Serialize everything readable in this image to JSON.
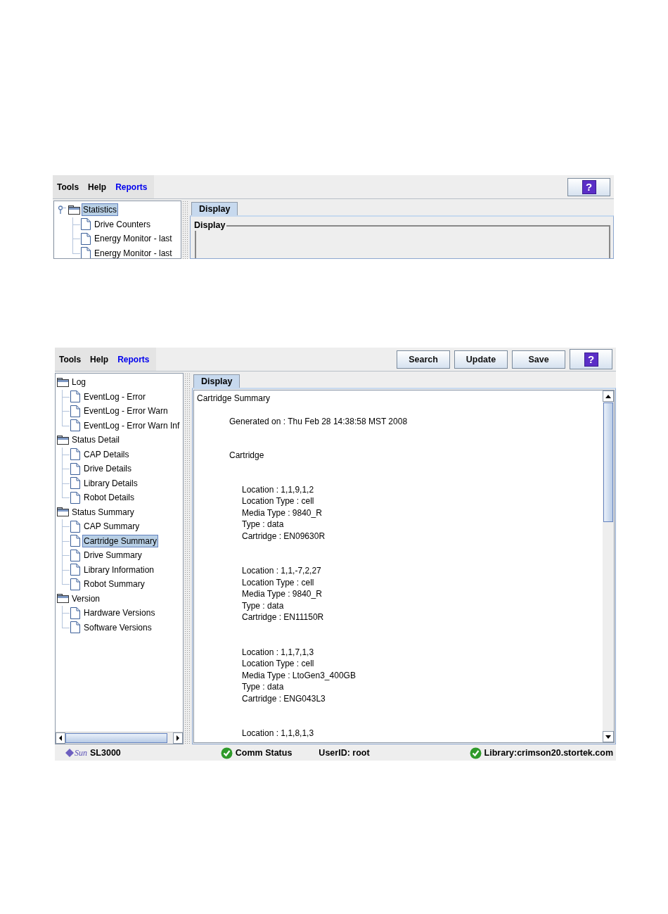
{
  "top_panel": {
    "menu": [
      {
        "label": "Tools",
        "selected": false
      },
      {
        "label": "Help",
        "selected": false
      },
      {
        "label": "Reports",
        "selected": true
      }
    ],
    "help_button": "?",
    "root_handles": true,
    "tree": [
      {
        "label": "Statistics",
        "selected": true,
        "expanded": true,
        "children": [
          {
            "label": "Drive Counters",
            "selected": false
          },
          {
            "label": "Energy Monitor - last",
            "selected": false
          },
          {
            "label": "Energy Monitor - last",
            "selected": false
          }
        ]
      }
    ],
    "tabs": [
      {
        "label": "Display",
        "selected": true
      }
    ],
    "group_title": "Display"
  },
  "bottom_panel": {
    "menu": [
      {
        "label": "Tools",
        "selected": false
      },
      {
        "label": "Help",
        "selected": false
      },
      {
        "label": "Reports",
        "selected": true
      }
    ],
    "buttons": [
      "Search",
      "Update",
      "Save"
    ],
    "help_button": "?",
    "root_handles": false,
    "tree": [
      {
        "label": "Log",
        "selected": false,
        "expanded": true,
        "children": [
          {
            "label": "EventLog - Error",
            "selected": false
          },
          {
            "label": "EventLog - Error Warn",
            "selected": false
          },
          {
            "label": "EventLog - Error Warn Inf",
            "selected": false
          }
        ]
      },
      {
        "label": "Status Detail",
        "selected": false,
        "expanded": true,
        "children": [
          {
            "label": "CAP Details",
            "selected": false
          },
          {
            "label": "Drive Details",
            "selected": false
          },
          {
            "label": "Library Details",
            "selected": false
          },
          {
            "label": "Robot Details",
            "selected": false
          }
        ]
      },
      {
        "label": "Status Summary",
        "selected": false,
        "expanded": true,
        "children": [
          {
            "label": "CAP Summary",
            "selected": false
          },
          {
            "label": "Cartridge Summary",
            "selected": true
          },
          {
            "label": "Drive Summary",
            "selected": false
          },
          {
            "label": "Library Information",
            "selected": false
          },
          {
            "label": "Robot Summary",
            "selected": false
          }
        ]
      },
      {
        "label": "Version",
        "selected": false,
        "expanded": true,
        "children": [
          {
            "label": "Hardware Versions",
            "selected": false
          },
          {
            "label": "Software Versions",
            "selected": false
          }
        ]
      }
    ],
    "tabs": [
      {
        "label": "Display",
        "selected": true
      }
    ],
    "report": {
      "title": "Cartridge Summary",
      "generated": "Generated on : Thu Feb 28 14:38:58 MST 2008",
      "section": "Cartridge",
      "records": [
        [
          "Location : 1,1,9,1,2",
          "Location Type : cell",
          "Media Type : 9840_R",
          "Type : data",
          "Cartridge : EN09630R"
        ],
        [
          "Location : 1,1,-7,2,27",
          "Location Type : cell",
          "Media Type : 9840_R",
          "Type : data",
          "Cartridge : EN11150R"
        ],
        [
          "Location : 1,1,7,1,3",
          "Location Type : cell",
          "Media Type : LtoGen3_400GB",
          "Type : data",
          "Cartridge : ENG043L3"
        ],
        [
          "Location : 1,1,8,1,3"
        ]
      ]
    },
    "status_bar": {
      "logo": "Sun",
      "product": "SL3000",
      "comm_status": "Comm Status",
      "user": "UserID: root",
      "library": "Library:crimson20.stortek.com"
    }
  }
}
